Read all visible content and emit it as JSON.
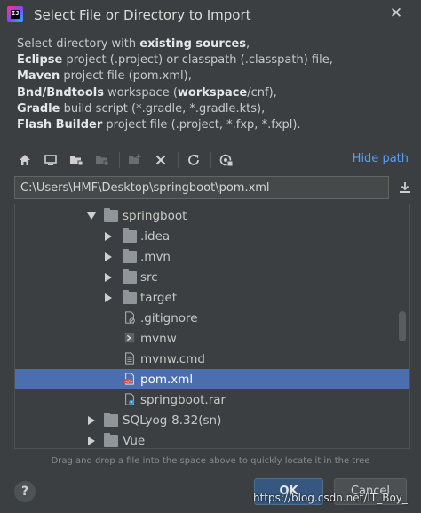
{
  "window": {
    "title": "Select File or Directory to Import",
    "app_icon_text": "IJ"
  },
  "description": {
    "intro_prefix": "Select directory with ",
    "intro_bold": "existing sources",
    "intro_suffix": ",",
    "lines": [
      {
        "bold": "Eclipse",
        "text": " project (.project) or classpath (.classpath) file,"
      },
      {
        "bold": "Maven",
        "text": " project file (pom.xml),"
      },
      {
        "bold": "Bnd/Bndtools",
        "text": " workspace (",
        "bold2": "workspace",
        "text2": "/cnf),"
      },
      {
        "bold": "Gradle",
        "text": " build script (*.gradle, *.gradle.kts),"
      },
      {
        "bold": "Flash Builder",
        "text": " project file (.project, *.fxp, *.fxpl)."
      }
    ]
  },
  "toolbar": {
    "icons": [
      "home-icon",
      "desktop-icon",
      "project-folder-icon",
      "module-folder-icon",
      "new-folder-icon",
      "delete-icon",
      "refresh-icon",
      "show-hidden-icon"
    ],
    "hide_path_label": "Hide path"
  },
  "path": {
    "value": "C:\\Users\\HMF\\Desktop\\springboot\\pom.xml"
  },
  "tree": {
    "items": [
      {
        "label": "springboot",
        "type": "folder",
        "expanded": true,
        "depth": 0
      },
      {
        "label": ".idea",
        "type": "folder",
        "expanded": false,
        "depth": 1
      },
      {
        "label": ".mvn",
        "type": "folder",
        "expanded": false,
        "depth": 1
      },
      {
        "label": "src",
        "type": "folder",
        "expanded": false,
        "depth": 1
      },
      {
        "label": "target",
        "type": "folder",
        "expanded": false,
        "depth": 1
      },
      {
        "label": ".gitignore",
        "type": "gitignore",
        "depth": 1
      },
      {
        "label": "mvnw",
        "type": "script",
        "depth": 1
      },
      {
        "label": "mvnw.cmd",
        "type": "text",
        "depth": 1
      },
      {
        "label": "pom.xml",
        "type": "maven",
        "depth": 1,
        "selected": true
      },
      {
        "label": "springboot.rar",
        "type": "unknown",
        "depth": 1
      },
      {
        "label": "SQLyog-8.32(sn)",
        "type": "folder",
        "expanded": false,
        "depth": 0
      },
      {
        "label": "Vue",
        "type": "folder",
        "expanded": false,
        "depth": 0
      }
    ]
  },
  "hint": "Drag and drop a file into the space above to quickly locate it in the tree",
  "buttons": {
    "help": "?",
    "ok": "OK",
    "cancel": "Cancel"
  },
  "watermark": "https://blog.csdn.net/IT_Boy_",
  "colors": {
    "background": "#3c3f41",
    "selection": "#4b6eaf",
    "link": "#589df6",
    "ok_button": "#365880"
  }
}
